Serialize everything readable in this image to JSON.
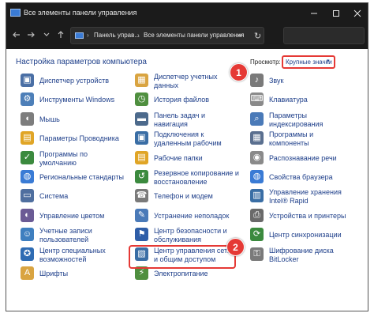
{
  "window": {
    "title": "Все элементы панели управления",
    "minimize_icon": "minimize-icon",
    "maximize_icon": "maximize-icon",
    "close_icon": "close-icon"
  },
  "address_bar": {
    "crumbs": [
      "Панель управ...",
      "Все элементы панели управления"
    ],
    "separator": "›",
    "dropdown_symbol": "⌄",
    "refresh_symbol": "↻",
    "search_value": ""
  },
  "content": {
    "heading": "Настройка параметров компьютера",
    "view_by_label": "Просмотр:",
    "view_by_value": "Крупные значки",
    "view_by_caret": "▾"
  },
  "annotations": {
    "badge1": "1",
    "badge2": "2",
    "accent_color": "#e53935"
  },
  "items": {
    "col1": [
      [
        "Диспетчер устройств"
      ],
      [
        "Инструменты Windows"
      ],
      [
        "Мышь"
      ],
      [
        "Параметры Проводника"
      ],
      [
        "Программы по",
        "умолчанию"
      ],
      [
        "Региональные стандарты"
      ],
      [
        "Система"
      ],
      [
        "Управление цветом"
      ],
      [
        "Учетные записи",
        "пользователей"
      ],
      [
        "Центр специальных",
        "возможностей"
      ],
      [
        "Шрифты"
      ]
    ],
    "col2": [
      [
        "Диспетчер учетных",
        "данных"
      ],
      [
        "История файлов"
      ],
      [
        "Панель задач и",
        "навигация"
      ],
      [
        "Подключения к",
        "удаленным рабочим"
      ],
      [
        "Рабочие папки"
      ],
      [
        "Резервное копирование и",
        "восстановление"
      ],
      [
        "Телефон и модем"
      ],
      [
        "Устранение неполадок"
      ],
      [
        "Центр безопасности и",
        "обслуживания"
      ],
      [
        "Центр управления сетями",
        "и общим доступом"
      ],
      [
        "Электропитание"
      ]
    ],
    "col3": [
      [
        "Звук"
      ],
      [
        "Клавиатура"
      ],
      [
        "Параметры",
        "индексирования"
      ],
      [
        "Программы и",
        "компоненты"
      ],
      [
        "Распознавание речи"
      ],
      [
        "Свойства браузера"
      ],
      [
        "Управление хранения",
        "Intel® Rapid"
      ],
      [
        "Устройства и принтеры"
      ],
      [
        "Центр синхронизации"
      ],
      [
        "Шифрование диска",
        "BitLocker"
      ]
    ]
  }
}
